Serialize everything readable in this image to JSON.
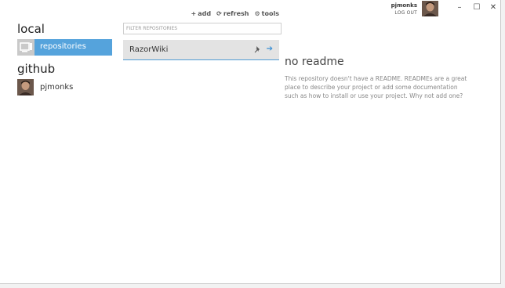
{
  "user": {
    "name": "pjmonks",
    "logout_label": "LOG OUT"
  },
  "window_controls": {
    "minimize": "–",
    "maximize": "☐",
    "close": "✕"
  },
  "toolbar": {
    "add_icon": "+",
    "add_label": "add",
    "refresh_icon": "⟳",
    "refresh_label": "refresh",
    "tools_icon": "⚙",
    "tools_label": "tools"
  },
  "sidebar": {
    "local_title": "local",
    "repositories_label": "repositories",
    "github_title": "github",
    "github_user": "pjmonks"
  },
  "repo_list": {
    "filter_placeholder": "FILTER REPOSITORIES",
    "items": [
      {
        "name": "RazorWiki",
        "pin_icon": "📌",
        "open_icon": "➔"
      }
    ]
  },
  "readme": {
    "title": "no readme",
    "body": "This repository doesn't have a README. READMEs are a great place to describe your project or add some documentation such as how to install or use your project. Why not add one?"
  },
  "colors": {
    "accent": "#55a3dc",
    "selected_border": "#4f9bd4"
  }
}
